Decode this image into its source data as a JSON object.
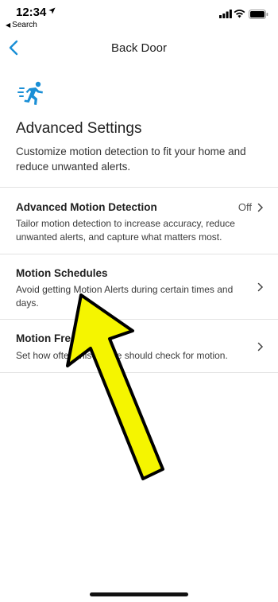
{
  "status_bar": {
    "time": "12:34",
    "back_app": "Search"
  },
  "nav": {
    "title": "Back Door"
  },
  "header": {
    "icon": "motion-running-icon",
    "title": "Advanced Settings",
    "description": "Customize motion detection to fit your home and reduce unwanted alerts."
  },
  "settings": [
    {
      "title": "Advanced Motion Detection",
      "value": "Off",
      "description": "Tailor motion detection to increase accuracy, reduce unwanted alerts, and capture what matters most."
    },
    {
      "title": "Motion Schedules",
      "description": "Avoid getting Motion Alerts during certain times and days."
    },
    {
      "title": "Motion Frequency",
      "description": "Set how often this device should check for motion."
    }
  ],
  "colors": {
    "accent": "#1a8fd6",
    "arrow_fill": "#f5f500",
    "arrow_stroke": "#000000"
  }
}
